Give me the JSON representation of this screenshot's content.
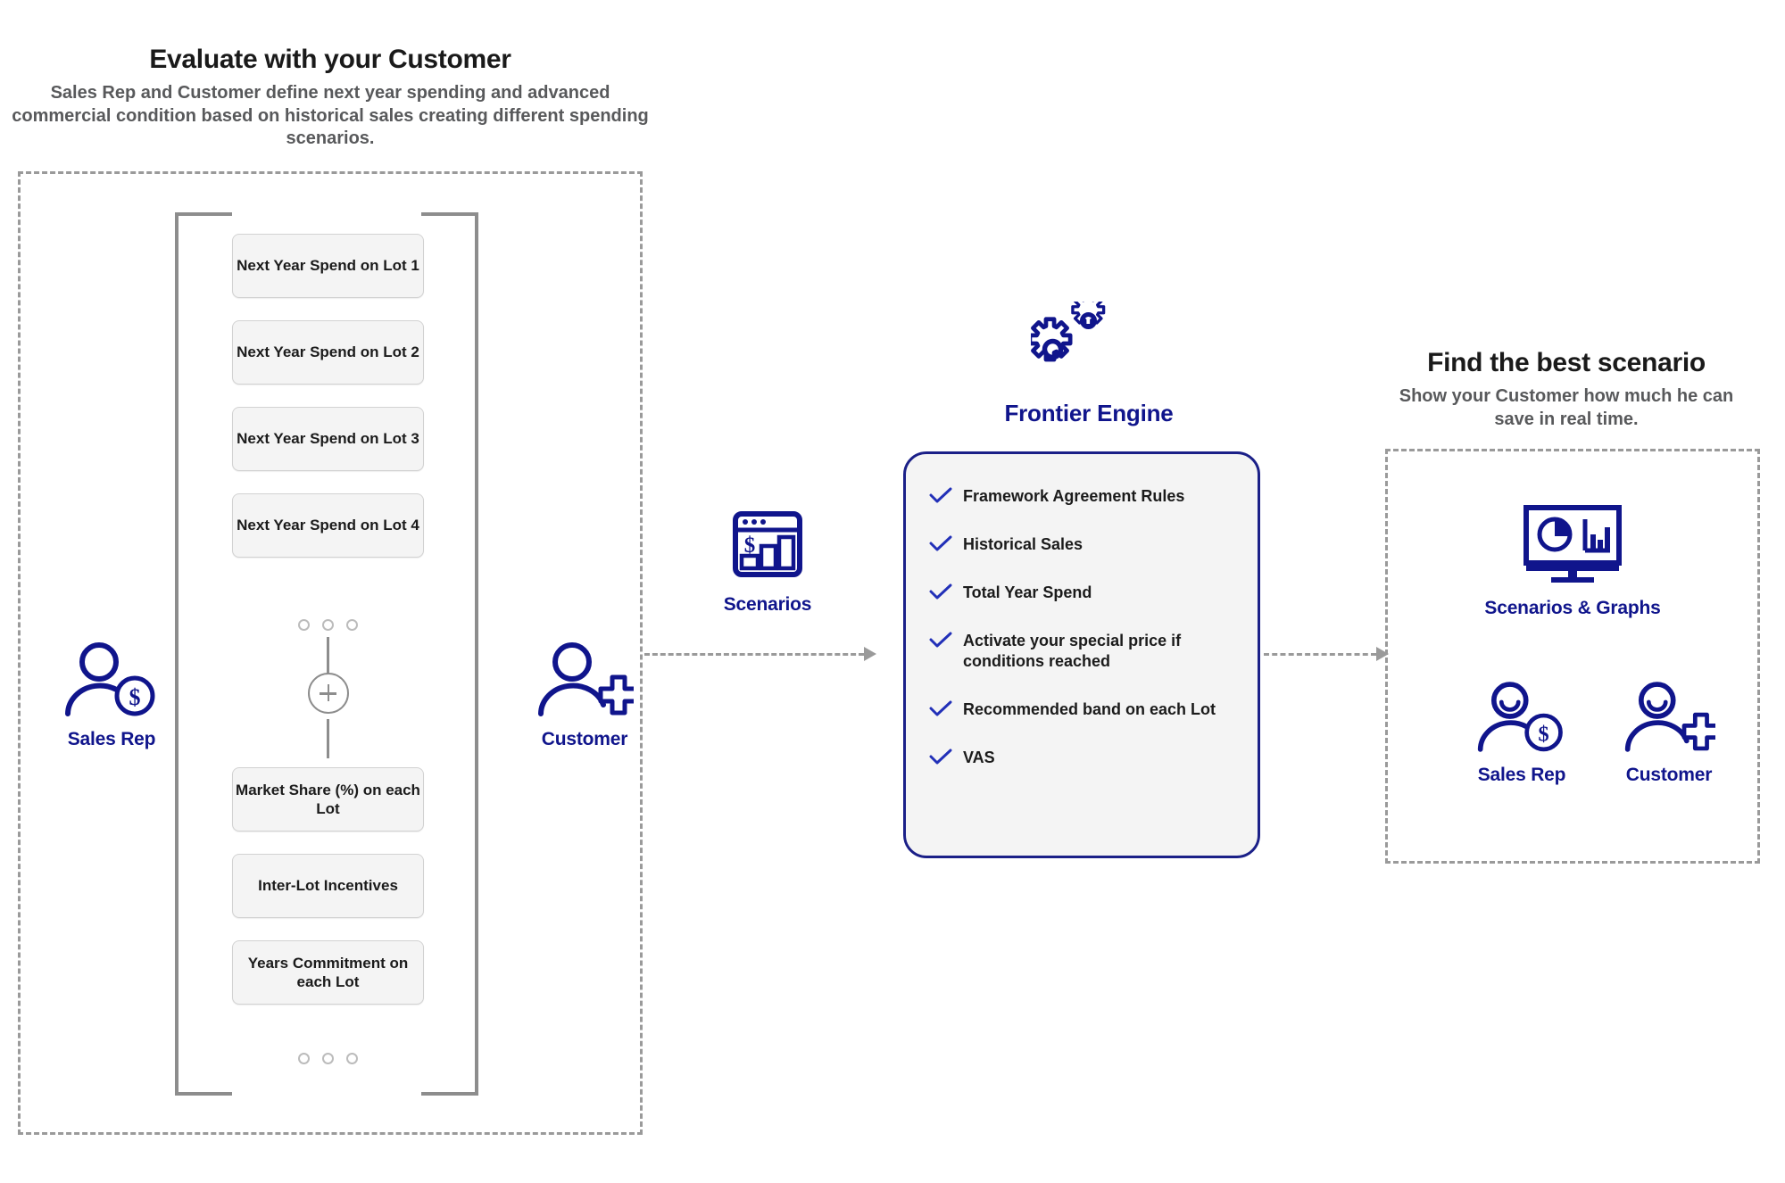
{
  "left_section": {
    "title": "Evaluate with your Customer",
    "subtitle": "Sales Rep and Customer define next year spending and advanced commercial condition based on historical sales creating different spending scenarios.",
    "boxes_top": [
      "Next Year Spend on Lot 1",
      "Next Year Spend on Lot 2",
      "Next Year Spend on Lot 3",
      "Next Year Spend on Lot 4"
    ],
    "boxes_bottom": [
      "Market Share (%) on each Lot",
      "Inter-Lot Incentives",
      "Years Commitment on each Lot"
    ],
    "connector_symbol": "+",
    "sales_rep_label": "Sales Rep",
    "customer_label": "Customer"
  },
  "scenarios": {
    "label": "Scenarios",
    "icon": "browser-bar-chart-dollar-icon"
  },
  "engine": {
    "title": "Frontier Engine",
    "icon": "gears-icon",
    "items": [
      "Framework Agreement Rules",
      "Historical Sales",
      "Total Year Spend",
      "Activate your special price if conditions reached",
      "Recommended band on each Lot",
      "VAS"
    ]
  },
  "right_section": {
    "title": "Find the best scenario",
    "subtitle": "Show your Customer how much he can save in real time.",
    "graphs_label": "Scenarios & Graphs",
    "graphs_icon": "monitor-charts-icon",
    "sales_rep_label": "Sales Rep",
    "customer_label": "Customer"
  },
  "colors": {
    "brand_blue": "#10158C",
    "panel_border_blue": "#1B2088",
    "box_fill": "#F4F4F4",
    "line_gray": "#9A9A9A",
    "text_dark": "#1A1A1A",
    "subtitle_gray": "#58595B"
  }
}
